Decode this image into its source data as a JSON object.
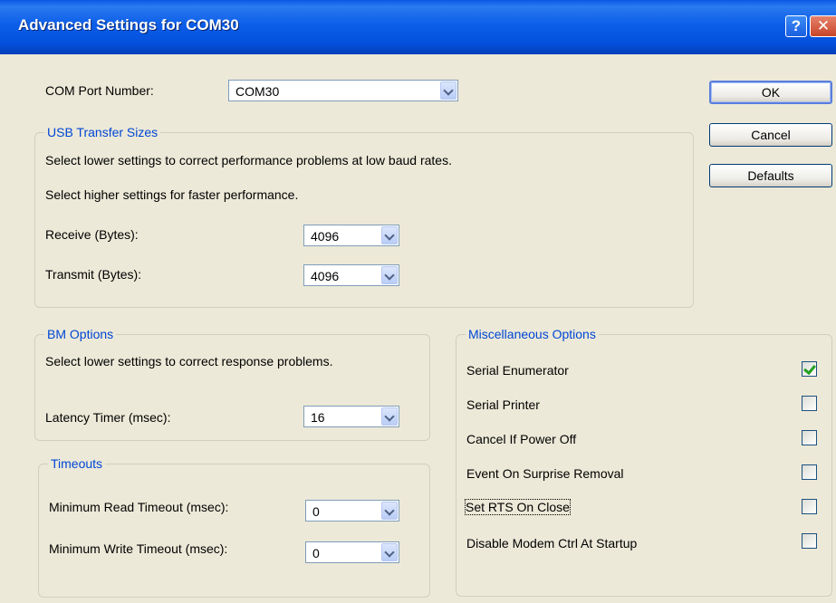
{
  "window": {
    "title": "Advanced Settings for COM30",
    "help_glyph": "?",
    "close_glyph": "✕"
  },
  "com_port": {
    "label": "COM Port Number:",
    "value": "COM30"
  },
  "buttons": {
    "ok": "OK",
    "cancel": "Cancel",
    "defaults": "Defaults"
  },
  "usb_transfer": {
    "title": "USB Transfer Sizes",
    "desc1": "Select lower settings to correct performance problems at low baud rates.",
    "desc2": "Select higher settings for faster performance.",
    "receive_label": "Receive (Bytes):",
    "receive_value": "4096",
    "transmit_label": "Transmit (Bytes):",
    "transmit_value": "4096"
  },
  "bm_options": {
    "title": "BM Options",
    "desc": "Select lower settings to correct response problems.",
    "latency_label": "Latency Timer (msec):",
    "latency_value": "16"
  },
  "timeouts": {
    "title": "Timeouts",
    "min_read_label": "Minimum Read Timeout (msec):",
    "min_read_value": "0",
    "min_write_label": "Minimum Write Timeout (msec):",
    "min_write_value": "0"
  },
  "misc": {
    "title": "Miscellaneous Options",
    "options": [
      {
        "label": "Serial Enumerator",
        "checked": true
      },
      {
        "label": "Serial Printer",
        "checked": false
      },
      {
        "label": "Cancel If Power Off",
        "checked": false
      },
      {
        "label": "Event On Surprise Removal",
        "checked": false
      },
      {
        "label": "Set RTS On Close",
        "checked": false
      },
      {
        "label": "Disable Modem Ctrl At Startup",
        "checked": false
      }
    ]
  },
  "colors": {
    "titlebar": "#0450dc",
    "group_title": "#0046d5",
    "dialog_bg": "#ece9d8",
    "check_mark": "#21a121"
  }
}
